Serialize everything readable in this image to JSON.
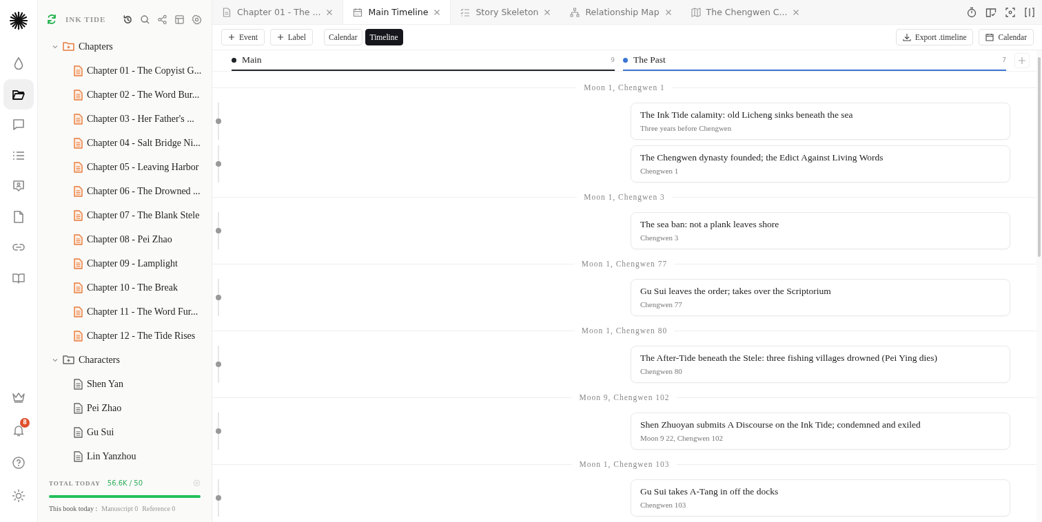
{
  "rail": [
    {
      "kind": "logo",
      "selected": false
    },
    {
      "kind": "drop",
      "selected": false
    },
    {
      "kind": "folder",
      "selected": true
    },
    {
      "kind": "chat",
      "selected": false
    },
    {
      "kind": "list",
      "selected": false
    },
    {
      "kind": "card",
      "selected": false
    },
    {
      "kind": "file",
      "selected": false
    },
    {
      "kind": "link",
      "selected": false
    },
    {
      "kind": "book",
      "selected": false
    }
  ],
  "rail_bottom": [
    {
      "kind": "crown"
    },
    {
      "kind": "bell",
      "badge": "8"
    },
    {
      "kind": "help"
    },
    {
      "kind": "sun"
    }
  ],
  "sidebar": {
    "title": "INK TIDE",
    "tree": [
      {
        "label": "Chapters",
        "expanded": true,
        "children": [
          {
            "label": "Chapter 01 - The Copyist G...",
            "kind": "chapter"
          },
          {
            "label": "Chapter 02 - The Word Bur...",
            "kind": "chapter"
          },
          {
            "label": "Chapter 03 - Her Father's ...",
            "kind": "chapter"
          },
          {
            "label": "Chapter 04 - Salt Bridge Ni...",
            "kind": "chapter"
          },
          {
            "label": "Chapter 05 - Leaving Harbor",
            "kind": "chapter"
          },
          {
            "label": "Chapter 06 - The Drowned ...",
            "kind": "chapter"
          },
          {
            "label": "Chapter 07 - The Blank Stele",
            "kind": "chapter"
          },
          {
            "label": "Chapter 08 - Pei Zhao",
            "kind": "chapter"
          },
          {
            "label": "Chapter 09 - Lamplight",
            "kind": "chapter"
          },
          {
            "label": "Chapter 10 - The Break",
            "kind": "chapter"
          },
          {
            "label": "Chapter 11 - The Word Fur...",
            "kind": "chapter"
          },
          {
            "label": "Chapter 12 - The Tide Rises",
            "kind": "chapter"
          }
        ]
      },
      {
        "label": "Characters",
        "expanded": true,
        "children": [
          {
            "label": "Shen Yan",
            "kind": "note"
          },
          {
            "label": "Pei Zhao",
            "kind": "note"
          },
          {
            "label": "Gu Sui",
            "kind": "note"
          },
          {
            "label": "Lin Yanzhou",
            "kind": "note"
          }
        ]
      }
    ],
    "footer": {
      "label": "TOTAL TODAY",
      "value": "56.6K / 50",
      "level": 1,
      "book_label": "This book today :",
      "manuscript": "Manuscript 0",
      "reference": "Reference 0"
    }
  },
  "tabs": [
    {
      "label": "Chapter 01 - The ...",
      "kind": "doc",
      "selected": false
    },
    {
      "label": "Main Timeline",
      "kind": "calendar",
      "selected": true
    },
    {
      "label": "Story Skeleton",
      "kind": "checklist",
      "selected": false
    },
    {
      "label": "Relationship Map",
      "kind": "hierarchy",
      "selected": false
    },
    {
      "label": "The Chengwen C...",
      "kind": "map",
      "selected": false
    }
  ],
  "toolbar": {
    "add_buttons": [
      "Event",
      "Label"
    ],
    "views": [
      {
        "label": "Calendar",
        "selected": false
      },
      {
        "label": "Timeline",
        "selected": true
      }
    ],
    "export": "Export .timeline",
    "calendar": "Calendar"
  },
  "lanes": [
    {
      "name": "Main",
      "count": "9",
      "color": "#1f2328"
    },
    {
      "name": "The Past",
      "count": "7",
      "color": "#3b74d1"
    }
  ],
  "groups": [
    {
      "date": "Moon 1, Chengwen 1",
      "events": [
        {
          "title": "The Ink Tide calamity: old Licheng sinks beneath the sea",
          "date": "Three years before Chengwen"
        },
        {
          "title": "The Chengwen dynasty founded; the Edict Against Living Words",
          "date": "Chengwen 1"
        }
      ]
    },
    {
      "date": "Moon 1, Chengwen 3",
      "events": [
        {
          "title": "The sea ban: not a plank leaves shore",
          "date": "Chengwen 3"
        }
      ]
    },
    {
      "date": "Moon 1, Chengwen 77",
      "events": [
        {
          "title": "Gu Sui leaves the order; takes over the Scriptorium",
          "date": "Chengwen 77"
        }
      ]
    },
    {
      "date": "Moon 1, Chengwen 80",
      "events": [
        {
          "title": "The After-Tide beneath the Stele: three fishing villages drowned (Pei Ying dies)",
          "date": "Chengwen 80"
        }
      ]
    },
    {
      "date": "Moon 9, Chengwen 102",
      "events": [
        {
          "title": "Shen Zhuoyan submits A Discourse on the Ink Tide; condemned and exiled",
          "date": "Moon 9 22, Chengwen 102"
        }
      ]
    },
    {
      "date": "Moon 1, Chengwen 103",
      "events": [
        {
          "title": "Gu Sui takes A-Tang in off the docks",
          "date": "Chengwen 103"
        }
      ]
    }
  ]
}
